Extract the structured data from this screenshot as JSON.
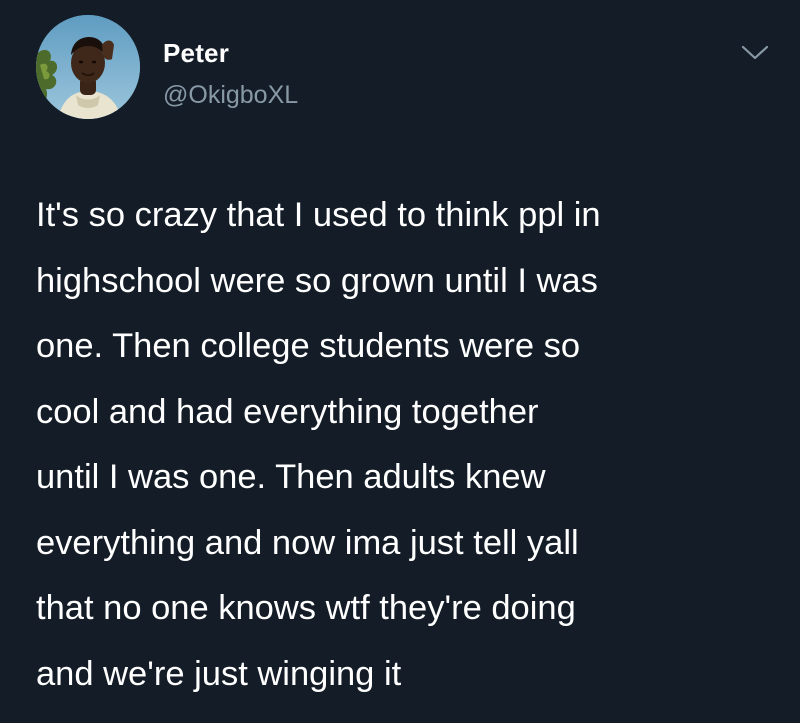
{
  "tweet": {
    "author": {
      "display_name": "Peter",
      "handle": "@OkigboXL",
      "avatar_icon": "profile-photo-icon"
    },
    "menu_icon": "chevron-down-icon",
    "text_lines": [
      "It's so crazy that I used to think ppl in",
      "highschool were so grown until I was",
      "one. Then college students were so",
      "cool and had everything together",
      "until I was one. Then adults knew",
      "everything and now ima just tell yall",
      "that no one knows wtf they're doing",
      "and we're just winging it"
    ]
  },
  "colors": {
    "background": "#141d27",
    "primary_text": "#ffffff",
    "secondary_text": "#8899a6"
  }
}
